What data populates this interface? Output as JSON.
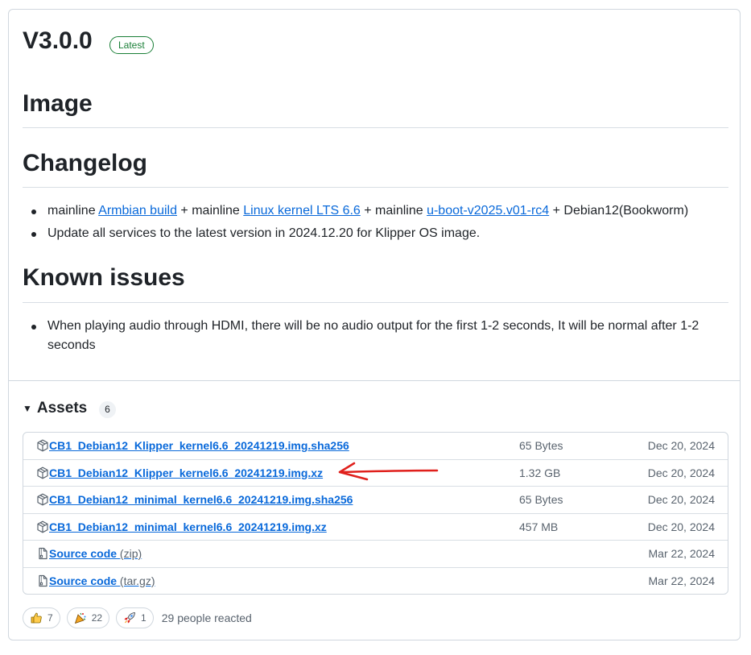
{
  "release": {
    "title": "V3.0.0",
    "badge": "Latest"
  },
  "sections": {
    "image": "Image",
    "changelog": "Changelog",
    "known_issues": "Known issues"
  },
  "changelog": {
    "item1": {
      "t1": "mainline ",
      "l1": "Armbian build",
      "t2": " + mainline ",
      "l2": "Linux kernel LTS 6.6",
      "t3": " + mainline ",
      "l3": "u-boot-v2025.v01-rc4",
      "t4": " + Debian12(Bookworm)"
    },
    "item2": "Update all services to the latest version in 2024.12.20 for Klipper OS image."
  },
  "known_issues": {
    "item1": "When playing audio through HDMI, there will be no audio output for the first 1-2 seconds, It will be normal after 1-2 seconds"
  },
  "assets": {
    "label": "Assets",
    "count": "6",
    "rows": [
      {
        "name": "CB1_Debian12_Klipper_kernel6.6_20241219.img.sha256",
        "ext": "",
        "size": "65 Bytes",
        "date": "Dec 20, 2024",
        "icon": "package-icon"
      },
      {
        "name": "CB1_Debian12_Klipper_kernel6.6_20241219.img.xz",
        "ext": "",
        "size": "1.32 GB",
        "date": "Dec 20, 2024",
        "icon": "package-icon"
      },
      {
        "name": "CB1_Debian12_minimal_kernel6.6_20241219.img.sha256",
        "ext": "",
        "size": "65 Bytes",
        "date": "Dec 20, 2024",
        "icon": "package-icon"
      },
      {
        "name": "CB1_Debian12_minimal_kernel6.6_20241219.img.xz",
        "ext": "",
        "size": "457 MB",
        "date": "Dec 20, 2024",
        "icon": "package-icon"
      },
      {
        "name": "Source code",
        "ext": "(zip)",
        "size": "",
        "date": "Mar 22, 2024",
        "icon": "file-zip-icon"
      },
      {
        "name": "Source code",
        "ext": "(tar.gz)",
        "size": "",
        "date": "Mar 22, 2024",
        "icon": "file-zip-icon"
      }
    ]
  },
  "reactions": {
    "thumbs_up": "7",
    "hooray": "22",
    "rocket": "1",
    "summary": "29 people reacted"
  },
  "colors": {
    "link": "#0969da",
    "latest_badge": "#1a7f37",
    "annotation_arrow": "#e0201c"
  }
}
